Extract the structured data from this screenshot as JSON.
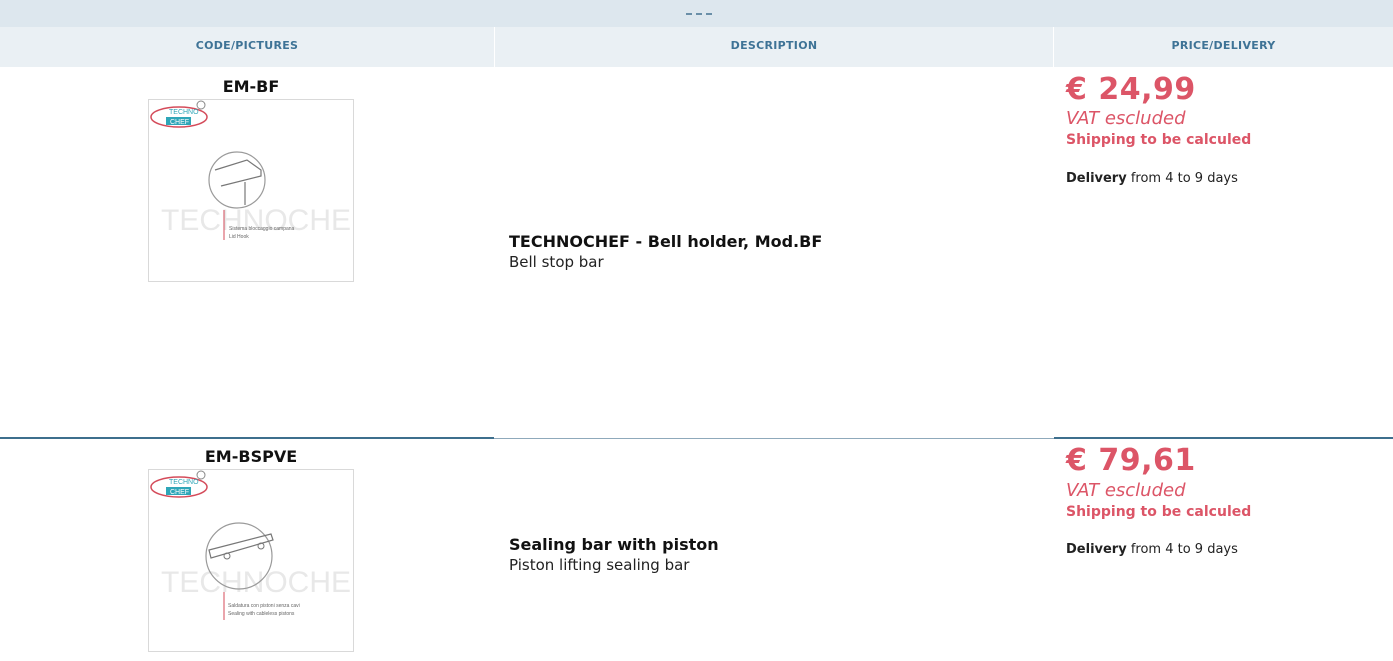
{
  "table": {
    "headers": {
      "code": "CODE/PICTURES",
      "description": "DESCRIPTION",
      "price": "PRICE/DELIVERY"
    },
    "rows": [
      {
        "code": "EM-BF",
        "image_caption_1": "Sistema bloccaggio campana",
        "image_caption_2": "Lid Hook",
        "watermark": "TECHNOCHEF.IT",
        "logo_top": "TECHNO",
        "logo_bottom": "CHEF",
        "title": "TECHNOCHEF - Bell holder, Mod.BF",
        "subtitle": "Bell stop bar",
        "price": "€ 24,99",
        "vat": "VAT escluded",
        "shipping": "Shipping to be calculed",
        "delivery_label": "Delivery",
        "delivery_text": " from 4 to 9 days"
      },
      {
        "code": "EM-BSPVE",
        "image_caption_1": "Saldatura con pistoni senza cavi",
        "image_caption_2": "Sealing with cableless pistons",
        "watermark": "TECHNOCHEF.IT",
        "logo_top": "TECHNO",
        "logo_bottom": "CHEF",
        "title": "Sealing bar with piston",
        "subtitle": "Piston lifting sealing bar",
        "price": "€ 79,61",
        "vat": "VAT escluded",
        "shipping": "Shipping to be calculed",
        "delivery_label": "Delivery",
        "delivery_text": " from 4 to 9 days"
      }
    ]
  },
  "colors": {
    "header_text": "#3e7396",
    "price": "#dc5567",
    "divider": "#3e6f8d"
  }
}
